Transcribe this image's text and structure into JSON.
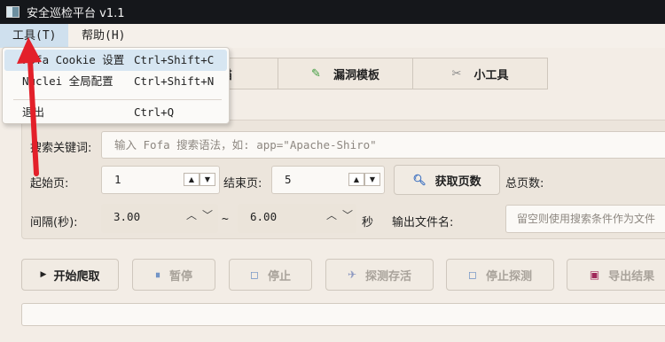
{
  "window": {
    "title": "安全巡检平台 v1.1"
  },
  "menubar": {
    "tools": "工具(T)",
    "help": "帮助(H)"
  },
  "dropdown": {
    "items": [
      {
        "label": "Fofa Cookie 设置",
        "shortcut": "Ctrl+Shift+C"
      },
      {
        "label": "Nuclei 全局配置",
        "shortcut": "Ctrl+Shift+N"
      },
      {
        "label": "退出",
        "shortcut": "Ctrl+Q"
      }
    ]
  },
  "tabs": [
    {
      "label": "扫描",
      "icon": "scan-icon"
    },
    {
      "label": "漏洞模板",
      "icon": "pencil-icon"
    },
    {
      "label": "小工具",
      "icon": "wrench-icon"
    }
  ],
  "form": {
    "keyword_label": "搜索关键词:",
    "keyword_placeholder": "输入 Fofa 搜索语法，如: app=\"Apache-Shiro\"",
    "start_label": "起始页:",
    "start_value": "1",
    "end_label": "结束页:",
    "end_value": "5",
    "fetch_pages": "获取页数",
    "total_label": "总页数:",
    "interval_label": "间隔(秒):",
    "interval_min": "3.00",
    "tilde": "~",
    "interval_max": "6.00",
    "seconds": "秒",
    "output_label": "输出文件名:",
    "output_placeholder": "留空则使用搜索条件作为文件"
  },
  "actions": {
    "start": "开始爬取",
    "pause": "暂停",
    "stop": "停止",
    "probe": "探测存活",
    "stop_probe": "停止探测",
    "export": "导出结果"
  },
  "colors": {
    "titlebar": "#15171b",
    "menu_highlight": "#cfe0ee",
    "annotation_arrow": "#e3202a"
  }
}
